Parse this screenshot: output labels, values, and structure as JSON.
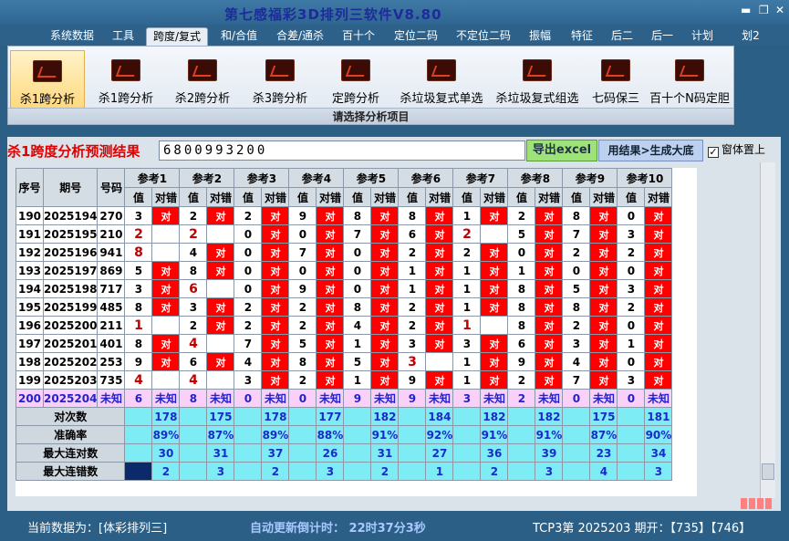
{
  "window": {
    "title": "第七感福彩3D排列三软件V8.80"
  },
  "menu": [
    "系统数据",
    "工具",
    "跨度/复式",
    "和/合值",
    "合差/通杀",
    "百十个",
    "定位二码",
    "不定位二码",
    "振幅",
    "特征",
    "后二",
    "后一",
    "计划",
    "划2"
  ],
  "ribbon": {
    "items": [
      "杀1跨分析",
      "杀1跨分析",
      "杀2跨分析",
      "杀3跨分析",
      "定跨分析",
      "杀垃圾复式单选",
      "杀垃圾复式组选",
      "七码保三",
      "百十个N码定胆"
    ],
    "footer": "请选择分析项目"
  },
  "result": {
    "title": "杀1跨度分析预测结果",
    "numbers": "6800993200",
    "export_label": "导出excel",
    "generate_label": "用结果>生成大底",
    "topmost_label": "窗体置上"
  },
  "table": {
    "headers": {
      "seq": "序号",
      "period": "期号",
      "code": "号码",
      "value": "值",
      "check": "对错"
    },
    "refs": [
      "参考1",
      "参考2",
      "参考3",
      "参考4",
      "参考5",
      "参考6",
      "参考7",
      "参考8",
      "参考9",
      "参考10"
    ],
    "hit_label": "对",
    "rows": [
      {
        "seq": "190",
        "period": "2025194",
        "code": "270",
        "cells": [
          [
            "3",
            "对"
          ],
          [
            "2",
            "对"
          ],
          [
            "2",
            "对"
          ],
          [
            "9",
            "对"
          ],
          [
            "8",
            "对"
          ],
          [
            "8",
            "对"
          ],
          [
            "1",
            "对"
          ],
          [
            "2",
            "对"
          ],
          [
            "8",
            "对"
          ],
          [
            "0",
            "对"
          ]
        ]
      },
      {
        "seq": "191",
        "period": "2025195",
        "code": "210",
        "cells": [
          [
            "2",
            ""
          ],
          [
            "2",
            ""
          ],
          [
            "0",
            "对"
          ],
          [
            "0",
            "对"
          ],
          [
            "7",
            "对"
          ],
          [
            "6",
            "对"
          ],
          [
            "2",
            ""
          ],
          [
            "5",
            "对"
          ],
          [
            "7",
            "对"
          ],
          [
            "3",
            "对"
          ]
        ]
      },
      {
        "seq": "192",
        "period": "2025196",
        "code": "941",
        "cells": [
          [
            "8",
            ""
          ],
          [
            "4",
            "对"
          ],
          [
            "0",
            "对"
          ],
          [
            "7",
            "对"
          ],
          [
            "0",
            "对"
          ],
          [
            "2",
            "对"
          ],
          [
            "2",
            "对"
          ],
          [
            "0",
            "对"
          ],
          [
            "2",
            "对"
          ],
          [
            "2",
            "对"
          ]
        ]
      },
      {
        "seq": "193",
        "period": "2025197",
        "code": "869",
        "cells": [
          [
            "5",
            "对"
          ],
          [
            "8",
            "对"
          ],
          [
            "0",
            "对"
          ],
          [
            "0",
            "对"
          ],
          [
            "0",
            "对"
          ],
          [
            "1",
            "对"
          ],
          [
            "1",
            "对"
          ],
          [
            "1",
            "对"
          ],
          [
            "0",
            "对"
          ],
          [
            "0",
            "对"
          ]
        ]
      },
      {
        "seq": "194",
        "period": "2025198",
        "code": "717",
        "cells": [
          [
            "3",
            "对"
          ],
          [
            "6",
            ""
          ],
          [
            "0",
            "对"
          ],
          [
            "9",
            "对"
          ],
          [
            "0",
            "对"
          ],
          [
            "1",
            "对"
          ],
          [
            "1",
            "对"
          ],
          [
            "8",
            "对"
          ],
          [
            "5",
            "对"
          ],
          [
            "3",
            "对"
          ]
        ]
      },
      {
        "seq": "195",
        "period": "2025199",
        "code": "485",
        "cells": [
          [
            "8",
            "对"
          ],
          [
            "3",
            "对"
          ],
          [
            "2",
            "对"
          ],
          [
            "2",
            "对"
          ],
          [
            "8",
            "对"
          ],
          [
            "2",
            "对"
          ],
          [
            "1",
            "对"
          ],
          [
            "8",
            "对"
          ],
          [
            "8",
            "对"
          ],
          [
            "2",
            "对"
          ]
        ]
      },
      {
        "seq": "196",
        "period": "2025200",
        "code": "211",
        "cells": [
          [
            "1",
            ""
          ],
          [
            "2",
            "对"
          ],
          [
            "2",
            "对"
          ],
          [
            "2",
            "对"
          ],
          [
            "4",
            "对"
          ],
          [
            "2",
            "对"
          ],
          [
            "1",
            ""
          ],
          [
            "8",
            "对"
          ],
          [
            "2",
            "对"
          ],
          [
            "0",
            "对"
          ]
        ]
      },
      {
        "seq": "197",
        "period": "2025201",
        "code": "401",
        "cells": [
          [
            "8",
            "对"
          ],
          [
            "4",
            ""
          ],
          [
            "7",
            "对"
          ],
          [
            "5",
            "对"
          ],
          [
            "1",
            "对"
          ],
          [
            "3",
            "对"
          ],
          [
            "3",
            "对"
          ],
          [
            "6",
            "对"
          ],
          [
            "3",
            "对"
          ],
          [
            "1",
            "对"
          ]
        ]
      },
      {
        "seq": "198",
        "period": "2025202",
        "code": "253",
        "cells": [
          [
            "9",
            "对"
          ],
          [
            "6",
            "对"
          ],
          [
            "4",
            "对"
          ],
          [
            "8",
            "对"
          ],
          [
            "5",
            "对"
          ],
          [
            "3",
            ""
          ],
          [
            "1",
            "对"
          ],
          [
            "9",
            "对"
          ],
          [
            "4",
            "对"
          ],
          [
            "0",
            "对"
          ]
        ]
      },
      {
        "seq": "199",
        "period": "2025203",
        "code": "735",
        "cells": [
          [
            "4",
            ""
          ],
          [
            "4",
            ""
          ],
          [
            "3",
            "对"
          ],
          [
            "2",
            "对"
          ],
          [
            "1",
            "对"
          ],
          [
            "9",
            "对"
          ],
          [
            "1",
            "对"
          ],
          [
            "2",
            "对"
          ],
          [
            "7",
            "对"
          ],
          [
            "3",
            "对"
          ]
        ]
      }
    ],
    "unknown_row": {
      "seq": "200",
      "period": "2025204",
      "code": "未知",
      "values": [
        "6",
        "8",
        "0",
        "0",
        "9",
        "9",
        "3",
        "2",
        "0",
        "0"
      ],
      "status": "未知"
    },
    "stats": [
      {
        "label": "对次数",
        "values": [
          "178",
          "175",
          "178",
          "177",
          "182",
          "184",
          "182",
          "182",
          "175",
          "181"
        ]
      },
      {
        "label": "准确率",
        "values": [
          "89%",
          "87%",
          "89%",
          "88%",
          "91%",
          "92%",
          "91%",
          "91%",
          "87%",
          "90%"
        ]
      },
      {
        "label": "最大连对数",
        "values": [
          "30",
          "31",
          "37",
          "26",
          "31",
          "27",
          "36",
          "39",
          "23",
          "34"
        ]
      },
      {
        "label": "最大连错数",
        "values": [
          "2",
          "3",
          "2",
          "3",
          "2",
          "1",
          "2",
          "3",
          "4",
          "3"
        ]
      }
    ]
  },
  "status": {
    "current": "当前数据为：[体彩排列三]",
    "countdown": "自动更新倒计时：   22时37分3秒",
    "draw": "TCP3第  2025203  期开：【735】【746】"
  },
  "colors": {
    "hit": "#ff0000",
    "stat": "#7eecf4",
    "unknown": "#fbd0f8",
    "title": "#e00000"
  }
}
